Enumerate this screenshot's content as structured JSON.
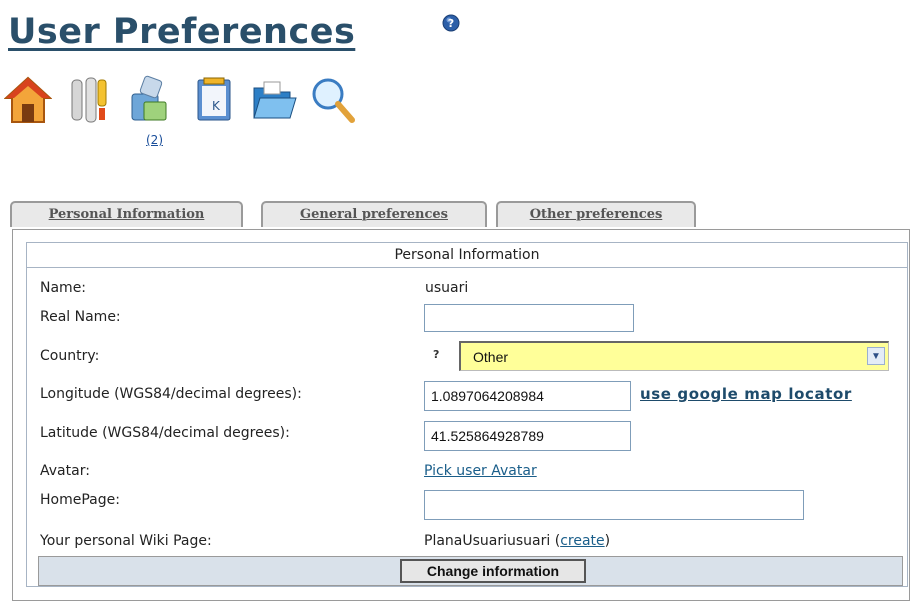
{
  "page": {
    "title": "User Preferences",
    "help_icon": "help-icon",
    "message_count": "(2)"
  },
  "toolbar": {
    "icons": [
      "home-icon",
      "tools-icon",
      "messages-icon",
      "notepad-icon",
      "folder-icon",
      "search-icon"
    ]
  },
  "tabs": [
    {
      "label": "Personal Information",
      "active": true
    },
    {
      "label": "General preferences",
      "active": false
    },
    {
      "label": "Other preferences",
      "active": false
    }
  ],
  "form": {
    "section_title": "Personal Information",
    "name_label": "Name:",
    "name_value": "usuari",
    "realname_label": "Real Name:",
    "realname_value": "",
    "country_label": "Country:",
    "country_hint": "?",
    "country_value": "Other",
    "longitude_label": "Longitude (WGS84/decimal degrees):",
    "longitude_value": "1.0897064208984",
    "map_link": "use google map locator",
    "latitude_label": "Latitude (WGS84/decimal degrees):",
    "latitude_value": "41.525864928789",
    "avatar_label": "Avatar:",
    "avatar_link": "Pick user Avatar",
    "homepage_label": "HomePage:",
    "homepage_value": "",
    "wiki_label": "Your personal Wiki Page:",
    "wiki_page": "PlanaUsuariusuari",
    "wiki_open": "(",
    "wiki_create": "create",
    "wiki_close": ")",
    "submit_label": "Change information"
  },
  "colors": {
    "title": "#2a4f6a",
    "select_bg": "#ffff99",
    "button_bar": "#d9e1ea"
  }
}
